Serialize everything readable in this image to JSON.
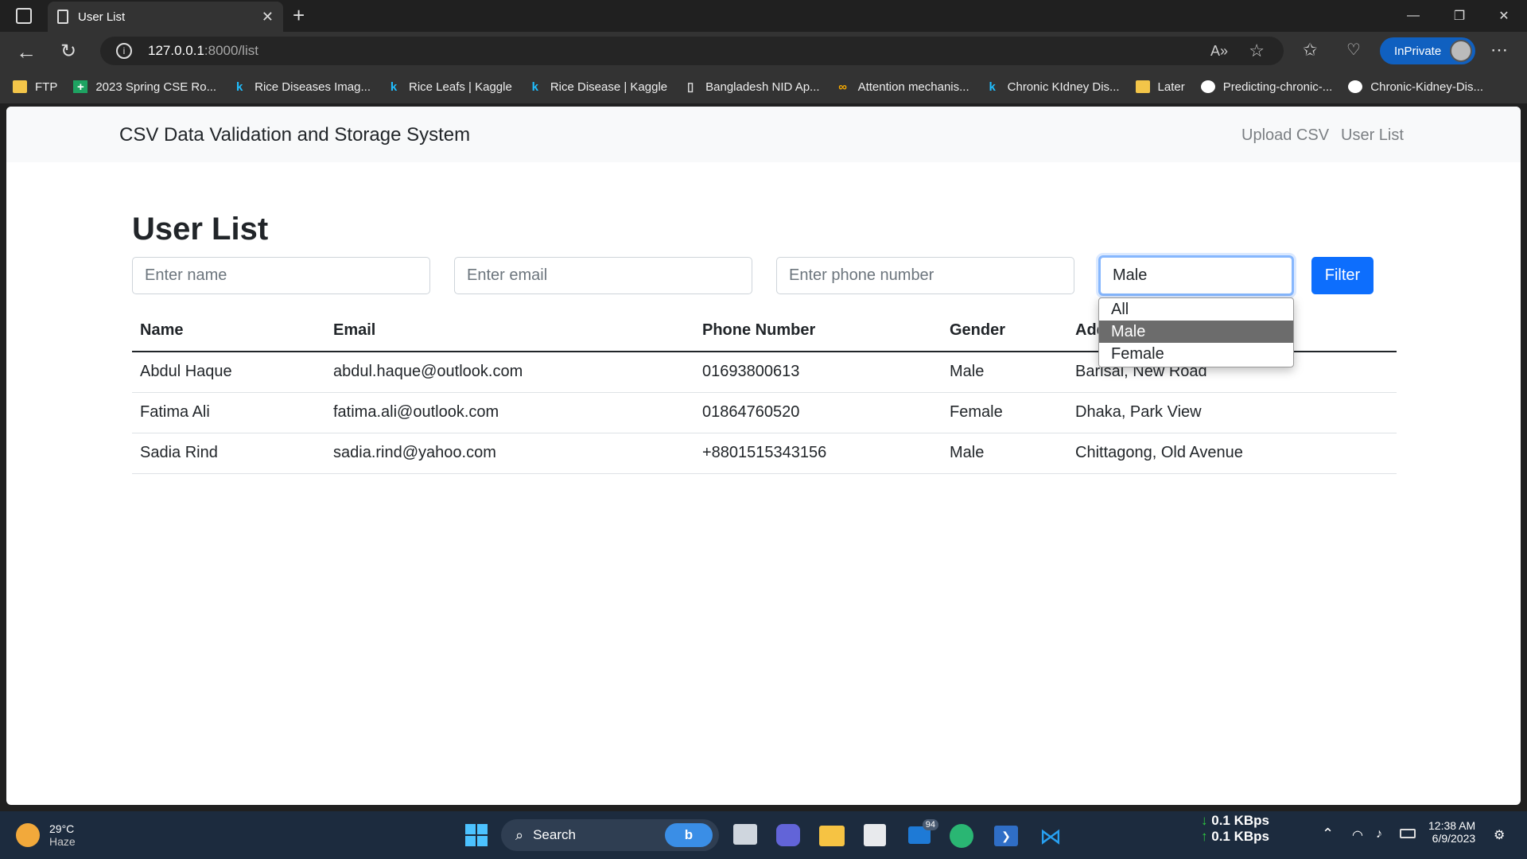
{
  "browser": {
    "tab_title": "User List",
    "url_host": "127.0.0.1",
    "url_path": ":8000/list",
    "inprivate_label": "InPrivate",
    "bookmarks": [
      {
        "label": "FTP",
        "icon": "folder-icon"
      },
      {
        "label": "2023 Spring CSE Ro...",
        "icon": "sheets-icon"
      },
      {
        "label": "Rice Diseases Imag...",
        "icon": "kaggle-icon"
      },
      {
        "label": "Rice Leafs | Kaggle",
        "icon": "kaggle-icon"
      },
      {
        "label": "Rice Disease | Kaggle",
        "icon": "kaggle-icon"
      },
      {
        "label": "Bangladesh NID Ap...",
        "icon": "document-icon"
      },
      {
        "label": "Attention mechanis...",
        "icon": "colab-icon"
      },
      {
        "label": "Chronic KIdney Dis...",
        "icon": "kaggle-icon"
      },
      {
        "label": "Later",
        "icon": "folder-icon"
      },
      {
        "label": "Predicting-chronic-...",
        "icon": "github-icon"
      },
      {
        "label": "Chronic-Kidney-Dis...",
        "icon": "github-icon"
      }
    ]
  },
  "navbar": {
    "brand": "CSV Data Validation and Storage System",
    "links": [
      "Upload CSV",
      "User List"
    ]
  },
  "main": {
    "title": "User List",
    "filters": {
      "name_placeholder": "Enter name",
      "email_placeholder": "Enter email",
      "phone_placeholder": "Enter phone number",
      "gender_value": "Male",
      "gender_options": [
        "All",
        "Male",
        "Female"
      ],
      "filter_button": "Filter"
    },
    "table": {
      "headers": [
        "Name",
        "Email",
        "Phone Number",
        "Gender",
        "Address"
      ],
      "rows": [
        [
          "Abdul Haque",
          "abdul.haque@outlook.com",
          "01693800613",
          "Male",
          "Barisal, New Road"
        ],
        [
          "Fatima Ali",
          "fatima.ali@outlook.com",
          "01864760520",
          "Female",
          "Dhaka, Park View"
        ],
        [
          "Sadia Rind",
          "sadia.rind@yahoo.com",
          "+8801515343156",
          "Male",
          "Chittagong, Old Avenue"
        ]
      ]
    }
  },
  "taskbar": {
    "weather_temp": "29°C",
    "weather_desc": "Haze",
    "search_label": "Search",
    "mail_badge": "94",
    "net_down": "0.1 KBps",
    "net_up": "0.1 KBps",
    "time": "12:38 AM",
    "date": "6/9/2023"
  }
}
